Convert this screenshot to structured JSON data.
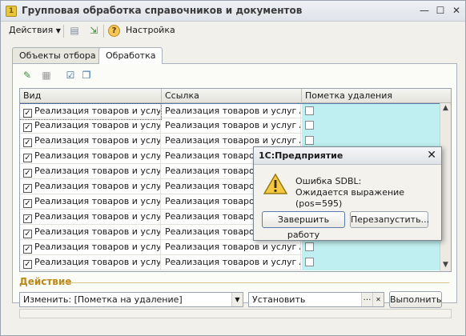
{
  "window": {
    "title": "Групповая обработка справочников и документов"
  },
  "toolbar": {
    "actions_label": "Действия",
    "settings_label": "Настройка"
  },
  "tabs": [
    {
      "label": "Объекты отбора"
    },
    {
      "label": "Обработка"
    }
  ],
  "table": {
    "columns": [
      "Вид",
      "Ссылка",
      "Пометка удаления"
    ],
    "rows": [
      {
        "kind": "Реализация товаров и услуг",
        "ref": "Реализация товаров и услуг А...",
        "checked": true,
        "marked": false
      },
      {
        "kind": "Реализация товаров и услуг",
        "ref": "Реализация товаров и услуг А...",
        "checked": true,
        "marked": false
      },
      {
        "kind": "Реализация товаров и услуг",
        "ref": "Реализация товаров и услуг А...",
        "checked": true,
        "marked": false
      },
      {
        "kind": "Реализация товаров и услуг",
        "ref": "Реализация товаров и услуг А...",
        "checked": true,
        "marked": false
      },
      {
        "kind": "Реализация товаров и услуг",
        "ref": "Реализация товаров и услуг А...",
        "checked": true,
        "marked": false
      },
      {
        "kind": "Реализация товаров и услуг",
        "ref": "Реализация товаров и услуг А...",
        "checked": true,
        "marked": false
      },
      {
        "kind": "Реализация товаров и услуг",
        "ref": "Реализация товаров и услуг А...",
        "checked": true,
        "marked": false
      },
      {
        "kind": "Реализация товаров и услуг",
        "ref": "Реализация товаров и услуг А...",
        "checked": true,
        "marked": false
      },
      {
        "kind": "Реализация товаров и услуг",
        "ref": "Реализация товаров и услуг А...",
        "checked": true,
        "marked": false
      },
      {
        "kind": "Реализация товаров и услуг",
        "ref": "Реализация товаров и услуг А...",
        "checked": true,
        "marked": false
      },
      {
        "kind": "Реализация товаров и услуг",
        "ref": "Реализация товаров и услуг А...",
        "checked": true,
        "marked": false
      }
    ]
  },
  "action": {
    "section_title": "Действие",
    "change_select": "Изменить: [Пометка на удаление]",
    "value_select": "Установить",
    "execute_label": "Выполнить"
  },
  "dialog": {
    "title": "1С:Предприятие",
    "message_line1": "Ошибка SDBL:",
    "message_line2": "Ожидается выражение (pos=595)",
    "button_exit": "Завершить работу",
    "button_restart": "Перезапустить..."
  }
}
